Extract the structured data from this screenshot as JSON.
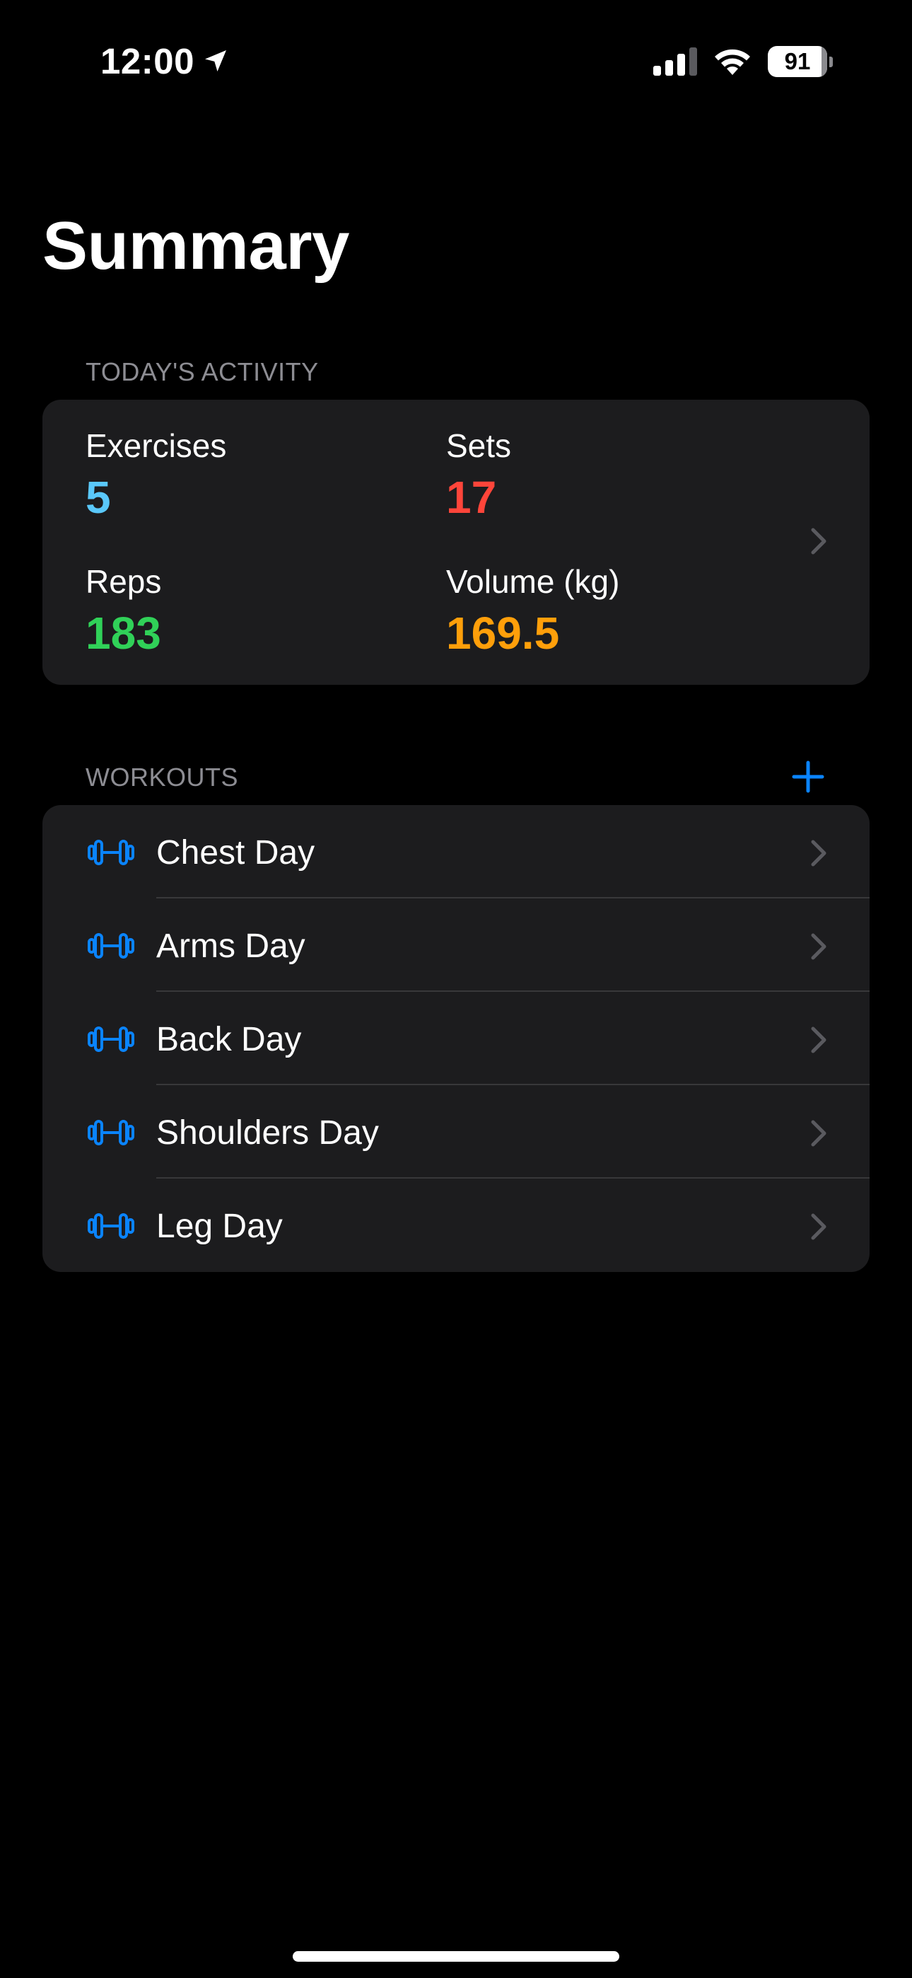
{
  "status_bar": {
    "time": "12:00",
    "battery_level": "91",
    "icons": [
      "location-arrow-icon",
      "cellular-signal-icon",
      "wifi-icon",
      "battery-icon"
    ]
  },
  "page": {
    "title": "Summary"
  },
  "activity": {
    "section_title": "TODAY'S ACTIVITY",
    "exercises": {
      "label": "Exercises",
      "value": "5",
      "color": "#5ac8fa"
    },
    "sets": {
      "label": "Sets",
      "value": "17",
      "color": "#ff453a"
    },
    "reps": {
      "label": "Reps",
      "value": "183",
      "color": "#30d158"
    },
    "volume": {
      "label": "Volume (kg)",
      "value": "169.5",
      "color": "#ff9f0a"
    }
  },
  "workouts": {
    "section_title": "WORKOUTS",
    "add_icon": "plus-icon",
    "accent_color": "#0a84ff",
    "items": [
      {
        "label": "Chest Day",
        "icon": "dumbbell-icon"
      },
      {
        "label": "Arms Day",
        "icon": "dumbbell-icon"
      },
      {
        "label": "Back Day",
        "icon": "dumbbell-icon"
      },
      {
        "label": "Shoulders Day",
        "icon": "dumbbell-icon"
      },
      {
        "label": "Leg Day",
        "icon": "dumbbell-icon"
      }
    ]
  },
  "theme": {
    "background": "#000000",
    "card_background": "#1c1c1e",
    "secondary_text": "#8d8d93",
    "chevron_color": "#5a5a5f"
  }
}
